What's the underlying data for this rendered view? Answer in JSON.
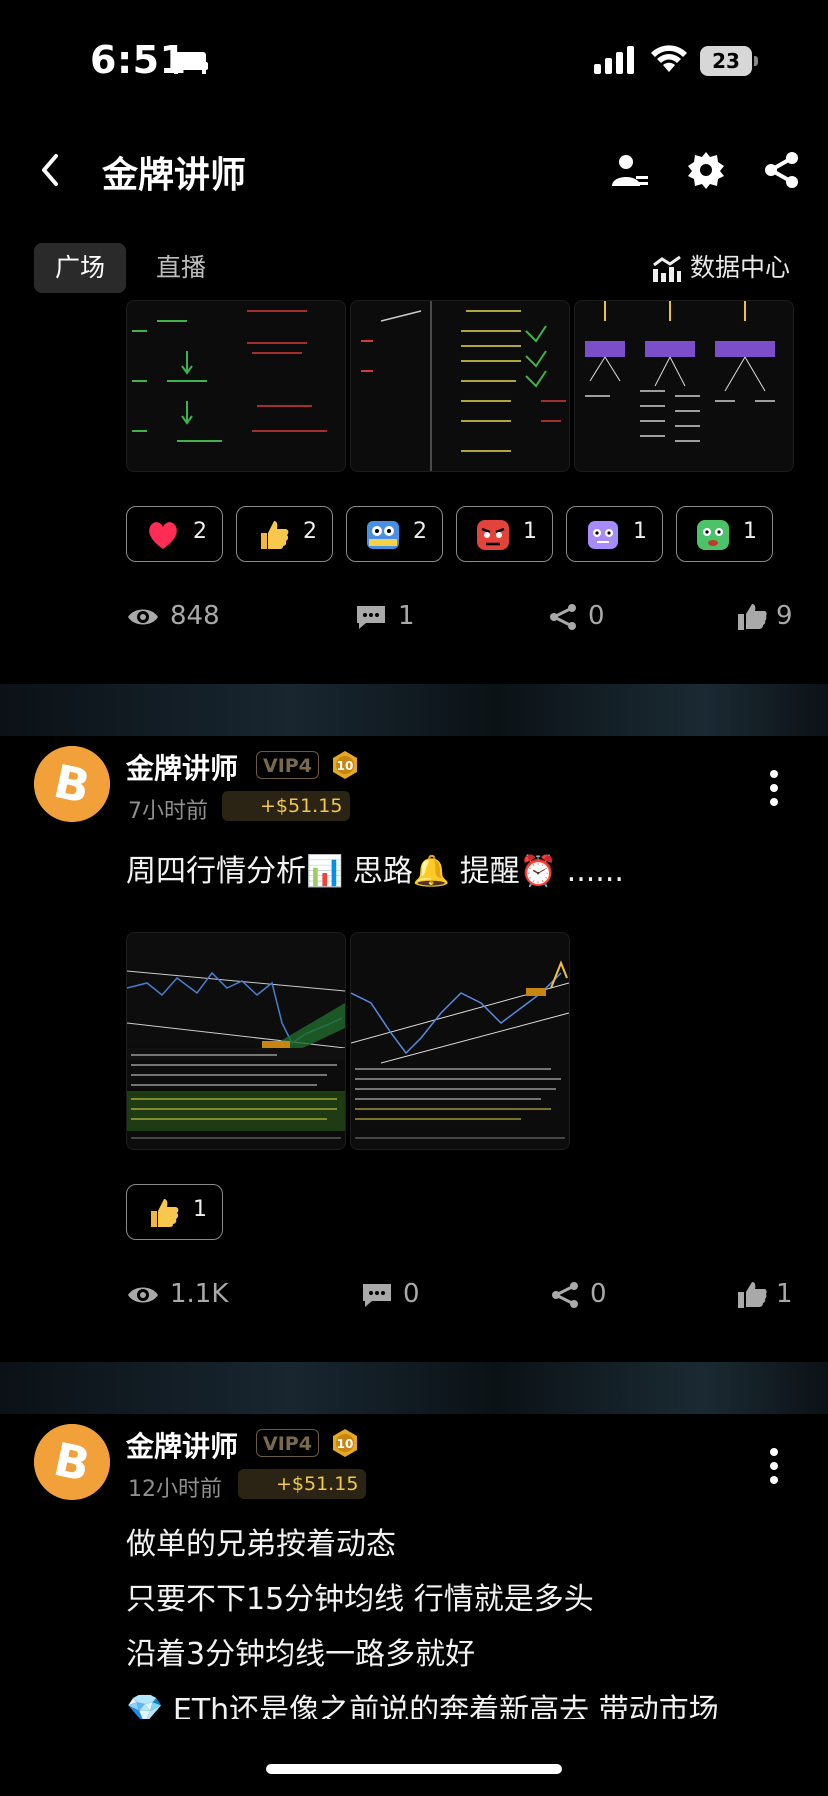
{
  "status_bar": {
    "time": "6:51",
    "battery": "23"
  },
  "header": {
    "title": "金牌讲师"
  },
  "tabs": {
    "active": "广场",
    "other": "直播",
    "data_center": "数据中心"
  },
  "post1": {
    "reactions": [
      {
        "icon": "heart-icon",
        "count": "2"
      },
      {
        "icon": "thumbs-up-icon",
        "count": "2"
      },
      {
        "icon": "hodl-robot-icon",
        "count": "2"
      },
      {
        "icon": "red-face-icon",
        "count": "1"
      },
      {
        "icon": "purple-robot-icon",
        "count": "1"
      },
      {
        "icon": "green-face-icon",
        "count": "1"
      }
    ],
    "views": "848",
    "comments": "1",
    "shares": "0",
    "likes": "9"
  },
  "post2": {
    "author": "金牌讲师",
    "vip": "VIP4",
    "level": "10",
    "time": "7小时前",
    "tip": "+$51.15",
    "text": "周四行情分析📊 思路🔔 提醒⏰ ......",
    "reactions": [
      {
        "icon": "thumbs-up-icon",
        "count": "1"
      }
    ],
    "views": "1.1K",
    "comments": "0",
    "shares": "0",
    "likes": "1"
  },
  "post3": {
    "author": "金牌讲师",
    "vip": "VIP4",
    "level": "10",
    "time": "12小时前",
    "tip": "+$51.15",
    "lines": [
      "做单的兄弟按着动态",
      "只要不下15分钟均线 行情就是多头",
      "沿着3分钟均线一路多就好",
      "💎 ETh还是像之前说的奔着新高去 带动市场"
    ]
  },
  "colors": {
    "accent_gold": "#f2c94c",
    "avatar_orange": "#f2a13a",
    "background": "#000000"
  }
}
